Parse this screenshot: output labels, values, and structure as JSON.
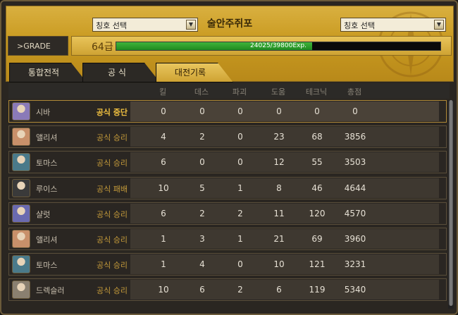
{
  "header": {
    "title": "술안주쥐포",
    "left_select": "칭호 선택",
    "right_select": "칭호 선택",
    "grade_label": "GRADE",
    "level": "64급",
    "exp_text": "24025/39800Exp.",
    "exp_fraction": 0.6036
  },
  "tabs": [
    {
      "label": "통합전적",
      "active": false
    },
    {
      "label": "공 식",
      "active": false
    },
    {
      "label": "대전기록",
      "active": true
    }
  ],
  "columns": [
    "킬",
    "데스",
    "파괴",
    "도움",
    "테크닉",
    "총점"
  ],
  "rows": [
    {
      "name": "시바",
      "result": "공식 중단",
      "avatar": "#8a7ab8",
      "stats": [
        "0",
        "0",
        "0",
        "0",
        "0",
        "0"
      ]
    },
    {
      "name": "앨리셔",
      "result": "공식 승리",
      "avatar": "#c8906a",
      "stats": [
        "4",
        "2",
        "0",
        "23",
        "68",
        "3856"
      ]
    },
    {
      "name": "토마스",
      "result": "공식 승리",
      "avatar": "#4a7a8a",
      "stats": [
        "6",
        "0",
        "0",
        "12",
        "55",
        "3503"
      ]
    },
    {
      "name": "루이스",
      "result": "공식 패배",
      "avatar": "#3a3a3a",
      "stats": [
        "10",
        "5",
        "1",
        "8",
        "46",
        "4644"
      ]
    },
    {
      "name": "샬럿",
      "result": "공식 승리",
      "avatar": "#6a6ab0",
      "stats": [
        "6",
        "2",
        "2",
        "11",
        "120",
        "4570"
      ]
    },
    {
      "name": "앨리셔",
      "result": "공식 승리",
      "avatar": "#c8906a",
      "stats": [
        "1",
        "3",
        "1",
        "21",
        "69",
        "3960"
      ]
    },
    {
      "name": "토마스",
      "result": "공식 승리",
      "avatar": "#4a7a8a",
      "stats": [
        "1",
        "4",
        "0",
        "10",
        "121",
        "3231"
      ]
    },
    {
      "name": "드렉슬러",
      "result": "공식 승리",
      "avatar": "#8a8070",
      "stats": [
        "10",
        "6",
        "2",
        "6",
        "119",
        "5340"
      ]
    }
  ]
}
